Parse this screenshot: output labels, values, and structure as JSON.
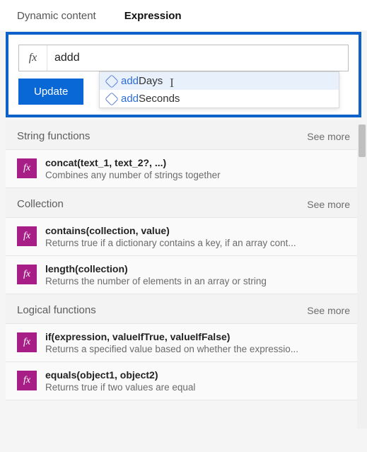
{
  "tabs": {
    "dynamic": "Dynamic content",
    "expression": "Expression"
  },
  "expression_box": {
    "fx_label": "fx",
    "input_value": "addd",
    "autocomplete": [
      {
        "match": "add",
        "rest": "Days",
        "selected": true
      },
      {
        "match": "add",
        "rest": "Seconds",
        "selected": false
      }
    ],
    "update_label": "Update"
  },
  "categories": [
    {
      "title": "String functions",
      "see_more": "See more",
      "items": [
        {
          "sig": "concat(text_1, text_2?, ...)",
          "desc": "Combines any number of strings together"
        }
      ]
    },
    {
      "title": "Collection",
      "see_more": "See more",
      "items": [
        {
          "sig": "contains(collection, value)",
          "desc": "Returns true if a dictionary contains a key, if an array cont..."
        },
        {
          "sig": "length(collection)",
          "desc": "Returns the number of elements in an array or string"
        }
      ]
    },
    {
      "title": "Logical functions",
      "see_more": "See more",
      "items": [
        {
          "sig": "if(expression, valueIfTrue, valueIfFalse)",
          "desc": "Returns a specified value based on whether the expressio..."
        },
        {
          "sig": "equals(object1, object2)",
          "desc": "Returns true if two values are equal"
        }
      ]
    }
  ]
}
